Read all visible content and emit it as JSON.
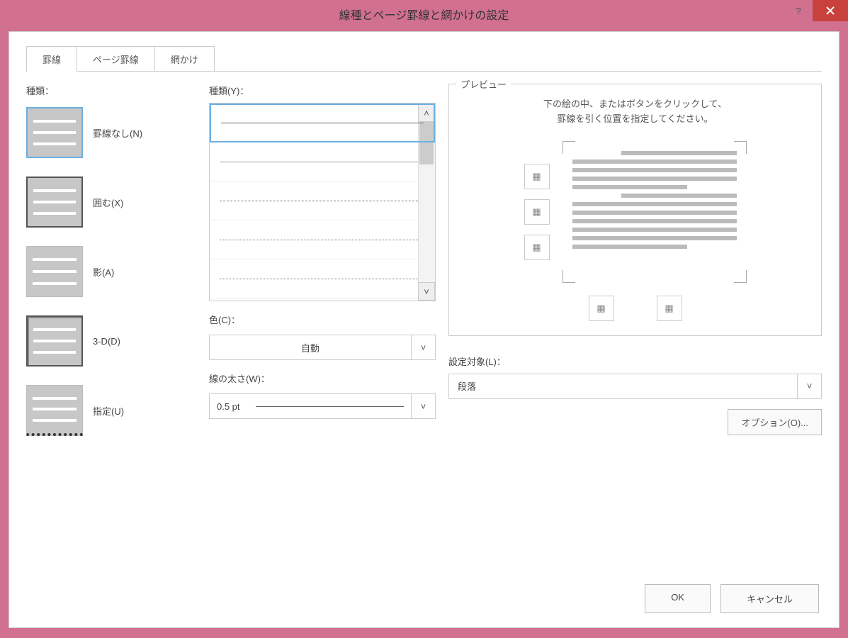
{
  "title": "線種とページ罫線と網かけの設定",
  "tabs": [
    "罫線",
    "ページ罫線",
    "網かけ"
  ],
  "setting": {
    "label": "種類：",
    "items": [
      {
        "label": "罫線なし(N)"
      },
      {
        "label": "囲む(X)"
      },
      {
        "label": "影(A)"
      },
      {
        "label": "3-D(D)"
      },
      {
        "label": "指定(U)"
      }
    ]
  },
  "style": {
    "label": "種類(Y)："
  },
  "color": {
    "label": "色(C)：",
    "value": "自動"
  },
  "width": {
    "label": "線の太さ(W)：",
    "value": "0.5 pt"
  },
  "preview": {
    "label": "プレビュー",
    "hint1": "下の絵の中、またはボタンをクリックして、",
    "hint2": "罫線を引く位置を指定してください。"
  },
  "apply": {
    "label": "設定対象(L)：",
    "value": "段落"
  },
  "options": "オプション(O)...",
  "ok": "OK",
  "cancel": "キャンセル",
  "help": "?"
}
